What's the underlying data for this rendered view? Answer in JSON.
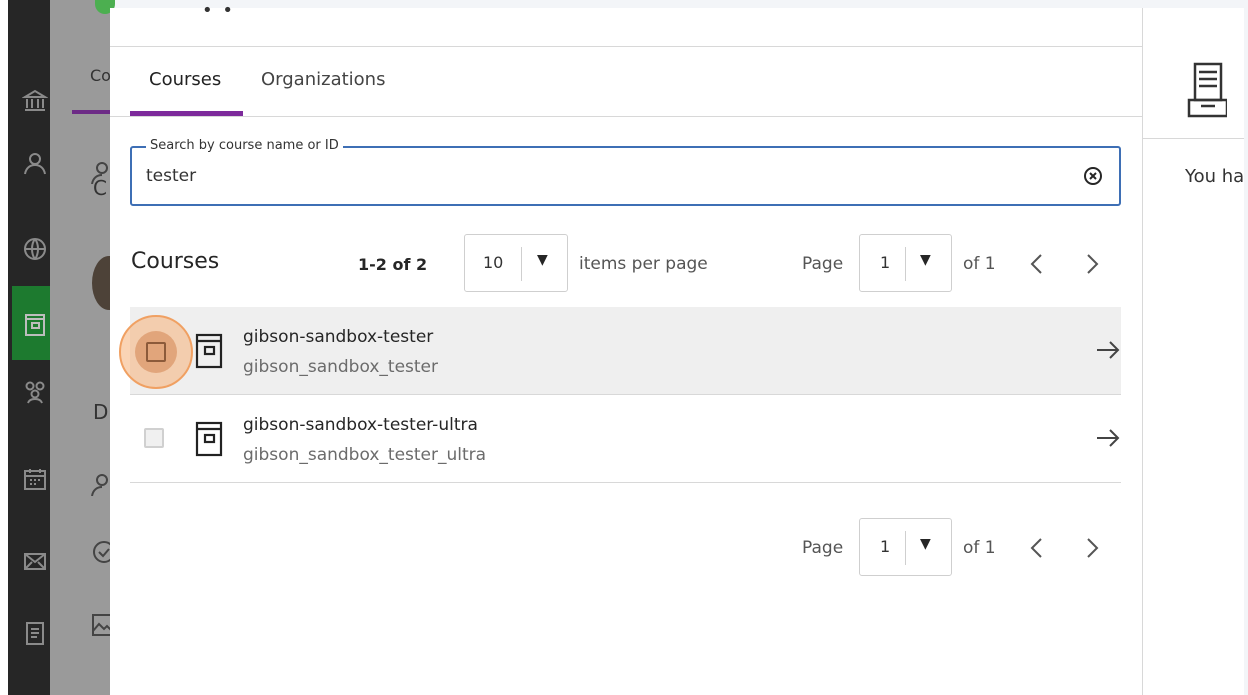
{
  "background": {
    "tab_partial": "Co",
    "heading_partial_1": "C",
    "heading_partial_2": "D",
    "nav_icons": [
      "institution-icon",
      "user-icon",
      "globe-icon",
      "courses-icon",
      "groups-icon",
      "calendar-icon",
      "mail-icon",
      "grades-icon"
    ]
  },
  "tabs": [
    {
      "label": "Courses",
      "active": true
    },
    {
      "label": "Organizations",
      "active": false
    }
  ],
  "search": {
    "label": "Search by course name or ID",
    "value": "tester"
  },
  "list": {
    "title": "Courses",
    "count": "1-2 of 2",
    "per_page_value": "10",
    "per_page_label": "items per page",
    "page_label": "Page",
    "page_value": "1",
    "of_label": "of 1"
  },
  "rows": [
    {
      "name": "gibson-sandbox-tester",
      "id": "gibson_sandbox_tester",
      "highlighted": true
    },
    {
      "name": "gibson-sandbox-tester-ultra",
      "id": "gibson_sandbox_tester_ultra",
      "highlighted": false
    }
  ],
  "footer_pager": {
    "page_label": "Page",
    "page_value": "1",
    "of_label": "of 1"
  },
  "side_panel": {
    "text": "You ha"
  },
  "colors": {
    "accent": "#7d2a9b",
    "focus_border": "#3e6fb5",
    "highlight_ring": "#f0a062",
    "nav_active": "#1d7a2f"
  }
}
